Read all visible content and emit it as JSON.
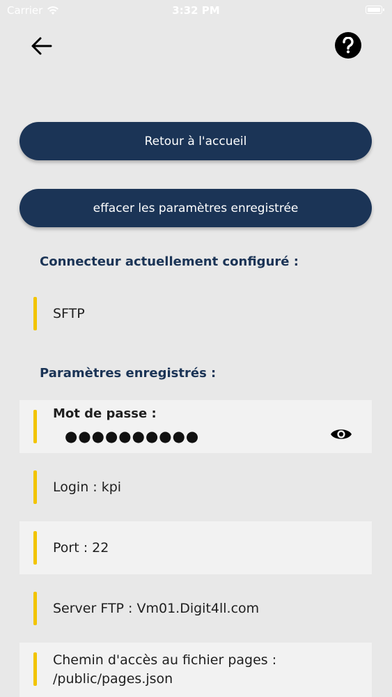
{
  "status_bar": {
    "carrier": "Carrier",
    "time": "3:32 PM"
  },
  "buttons": {
    "home_label": "Retour à l'accueil",
    "clear_label": "effacer les paramètres enregistrée"
  },
  "connector": {
    "title": "Connecteur actuellement configuré :",
    "value": "SFTP"
  },
  "params": {
    "title": "Paramètres enregistrés :",
    "password_label": "Mot de passe :",
    "password_masked": "●●●●●●●●●●",
    "login": "Login : kpi",
    "port": "Port : 22",
    "server": "Server FTP : Vm01.Digit4ll.com",
    "path_line1": "Chemin d'accès au fichier pages :",
    "path_line2": "/public/pages.json"
  },
  "icons": {
    "back": "arrow-left-icon",
    "help": "question-circle-icon",
    "eye": "eye-icon",
    "wifi": "wifi-icon",
    "battery": "battery-icon"
  },
  "colors": {
    "primary": "#1b3456",
    "accent": "#f2c400",
    "background": "#e8e8e8",
    "row_light": "#f2f2f2"
  }
}
